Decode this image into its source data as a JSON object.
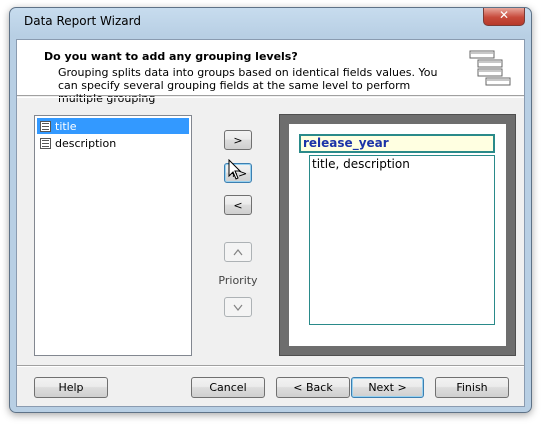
{
  "window": {
    "title": "Data Report Wizard"
  },
  "header": {
    "title": "Do you want to add any grouping levels?",
    "description": "Grouping splits data into groups based on identical fields values. You can specify several grouping fields at the same level to perform multiple grouping"
  },
  "fields": {
    "items": [
      {
        "label": "title",
        "selected": true
      },
      {
        "label": "description",
        "selected": false
      }
    ]
  },
  "controls": {
    "add": ">",
    "add_multiple": "+>",
    "remove": "<",
    "priority_up": "^",
    "priority_down": "v",
    "priority_label": "Priority"
  },
  "preview": {
    "group_field": "release_year",
    "detail_fields": "title, description"
  },
  "footer": {
    "help": "Help",
    "cancel": "Cancel",
    "back": "< Back",
    "next": "Next >",
    "finish": "Finish"
  },
  "colors": {
    "selection": "#3399ff",
    "group_header_text": "#1b33a8",
    "group_border": "#2a8a8a"
  }
}
